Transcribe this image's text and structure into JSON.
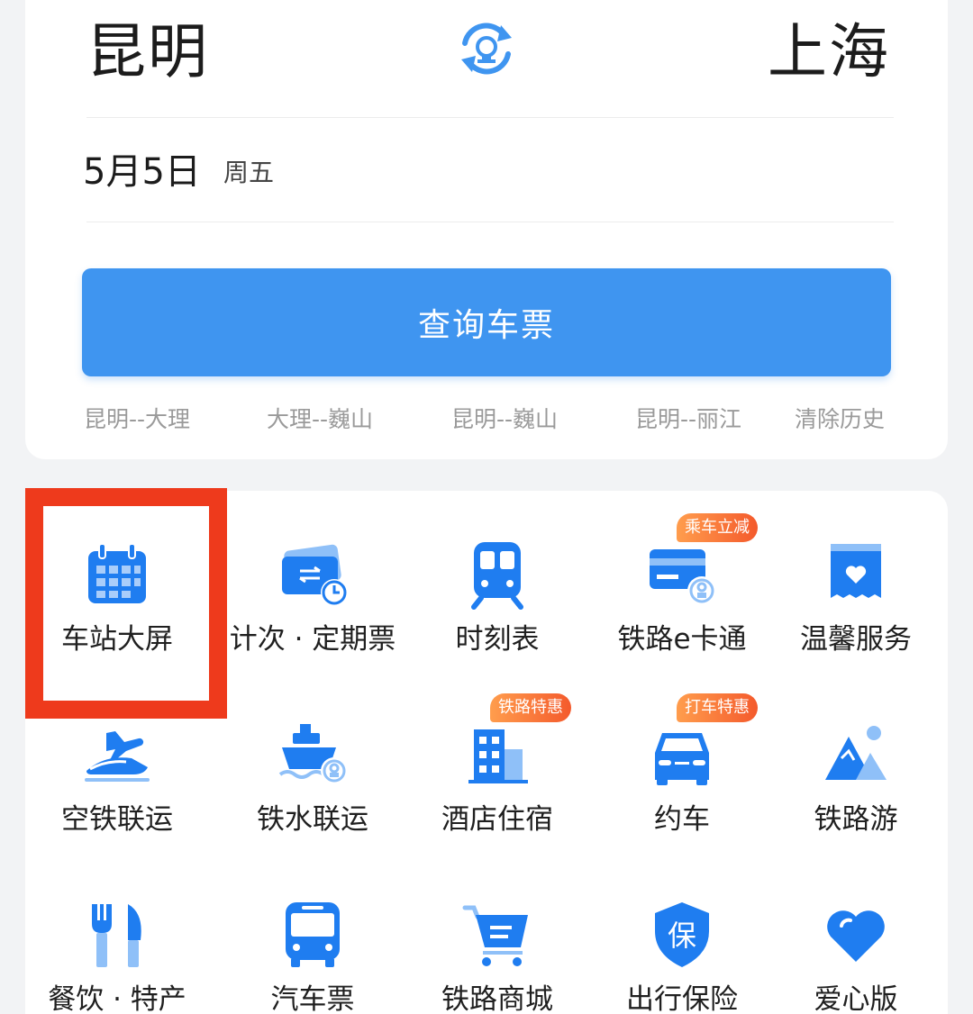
{
  "route": {
    "from_city": "昆明",
    "to_city": "上海"
  },
  "date": {
    "value": "5月5日",
    "weekday": "周五"
  },
  "search_button_label": "查询车票",
  "history": [
    "昆明--大理",
    "大理--巍山",
    "昆明--巍山",
    "昆明--丽江"
  ],
  "clear_history_label": "清除历史",
  "services": [
    {
      "label": "车站大屏",
      "icon": "calendar-icon"
    },
    {
      "label": "计次 · 定期票",
      "icon": "ticket-clock-icon"
    },
    {
      "label": "时刻表",
      "icon": "train-icon"
    },
    {
      "label": "铁路e卡通",
      "icon": "card-icon",
      "badge": "乘车立减"
    },
    {
      "label": "温馨服务",
      "icon": "heart-box-icon"
    },
    {
      "label": "空铁联运",
      "icon": "plane-train-icon"
    },
    {
      "label": "铁水联运",
      "icon": "ship-icon"
    },
    {
      "label": "酒店住宿",
      "icon": "hotel-icon",
      "badge": "铁路特惠"
    },
    {
      "label": "约车",
      "icon": "car-icon",
      "badge": "打车特惠"
    },
    {
      "label": "铁路游",
      "icon": "mountain-icon"
    },
    {
      "label": "餐饮 · 特产",
      "icon": "fork-knife-icon"
    },
    {
      "label": "汽车票",
      "icon": "bus-icon"
    },
    {
      "label": "铁路商城",
      "icon": "cart-icon"
    },
    {
      "label": "出行保险",
      "icon": "shield-icon",
      "shield_char": "保"
    },
    {
      "label": "爱心版",
      "icon": "heart-icon"
    }
  ],
  "colors": {
    "accent": "#3f95f0",
    "icon_blue": "#1f7df0",
    "highlight": "#ee3a1c",
    "badge": "#f45a2c"
  }
}
